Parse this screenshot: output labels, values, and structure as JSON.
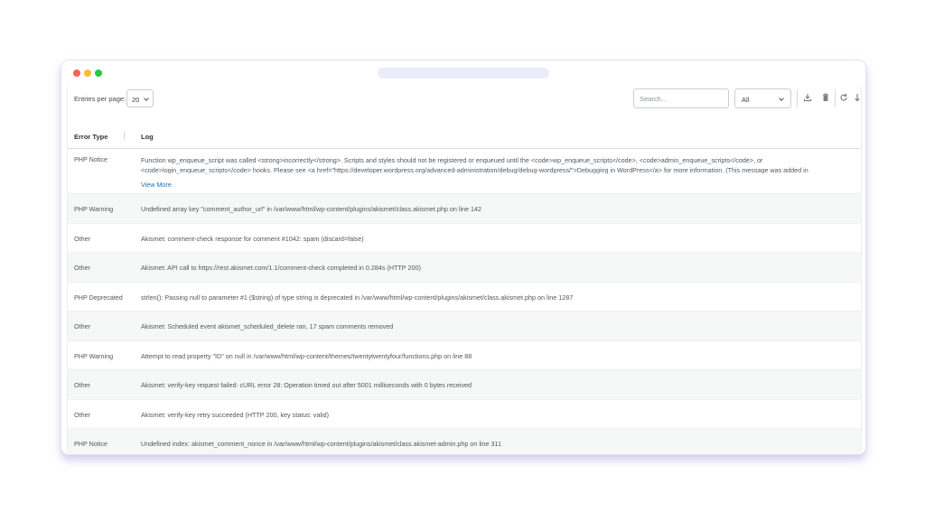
{
  "toolbar": {
    "entries_label": "Entries per page:",
    "entries_value": "20",
    "search_placeholder": "Search...",
    "filter_value": "All",
    "icons": [
      "download-icon",
      "trash-icon",
      "refresh-icon",
      "arrow-down-icon"
    ]
  },
  "table": {
    "headers": {
      "type": "Error Type",
      "log": "Log"
    },
    "view_more": "View More",
    "rows": [
      {
        "type": "PHP Notice",
        "log": "Function wp_enqueue_script was called <strong>incorrectly</strong>. Scripts and styles should not be registered or enqueued until the <code>wp_enqueue_scripts</code>, <code>admin_enqueue_scripts</code>, or <code>login_enqueue_scripts</code> hooks. Please see <a href=\"https://developer.wordpress.org/advanced-administration/debug/debug-wordpress/\">Debugging in WordPress</a> for more information. (This message was added in"
      },
      {
        "type": "PHP Warning",
        "log": "Undefined array key \"comment_author_url\" in /var/www/html/wp-content/plugins/akismet/class.akismet.php on line 142"
      },
      {
        "type": "Other",
        "log": "Akismet: comment-check response for comment #1042: spam (discard=false)"
      },
      {
        "type": "Other",
        "log": "Akismet: API call to https://rest.akismet.com/1.1/comment-check completed in 0.284s (HTTP 200)"
      },
      {
        "type": "PHP Deprecated",
        "log": "strlen(): Passing null to parameter #1 ($string) of type string is deprecated in /var/www/html/wp-content/plugins/akismet/class.akismet.php on line 1287"
      },
      {
        "type": "Other",
        "log": "Akismet: Scheduled event akismet_scheduled_delete ran, 17 spam comments removed"
      },
      {
        "type": "PHP Warning",
        "log": "Attempt to read property \"ID\" on null in /var/www/html/wp-content/themes/twentytwentyfour/functions.php on line 88"
      },
      {
        "type": "Other",
        "log": "Akismet: verify-key request failed: cURL error 28: Operation timed out after 5001 milliseconds with 0 bytes received"
      },
      {
        "type": "Other",
        "log": "Akismet: verify-key retry succeeded (HTTP 200, key status: valid)"
      },
      {
        "type": "PHP Notice",
        "log": "Undefined index: akismet_comment_nonce in /var/www/html/wp-content/plugins/akismet/class.akismet-admin.php on line 311"
      }
    ]
  }
}
